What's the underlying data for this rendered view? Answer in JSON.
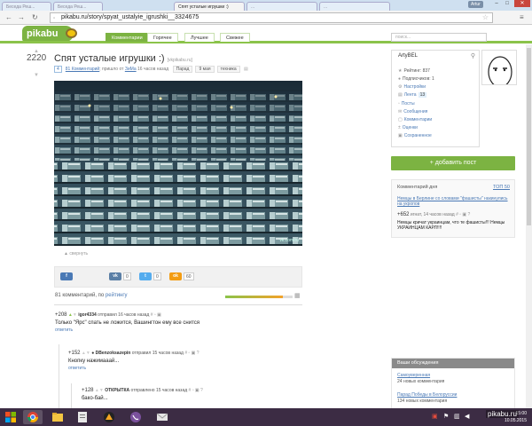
{
  "browser": {
    "tabs": [
      {
        "label": "Беседа Реш..."
      },
      {
        "label": "Беседа Реш..."
      },
      {
        "label": "Спят усталые игрушки :)"
      },
      {
        "label": "..."
      },
      {
        "label": "..."
      }
    ],
    "user": "Artur",
    "url": "pikabu.ru/story/spyat_ustalyie_igrushki__3324675"
  },
  "site": {
    "logo": "pikabu",
    "nav": [
      "Комментарии",
      "Горячее",
      "Лучшее",
      "Свежее"
    ],
    "search_placeholder": "поиск..."
  },
  "post": {
    "rating": "2220",
    "title": "Спят усталые игрушки :)",
    "source": "[vkpikabu.ru]",
    "badge": "4",
    "comments_link": "81 Комментарий",
    "posted_prefix": "; пришло от",
    "author": "ЗиМа",
    "time": "16 часов назад",
    "tags": [
      "Парад",
      "9 мая",
      "техника"
    ],
    "photo_watermark": "vk.com/ru"
  },
  "collapse_label": "свернуть",
  "share": {
    "counts": [
      "0",
      "0",
      "60"
    ]
  },
  "comments": {
    "count_text": "81 комментарий, по",
    "sort": "рейтингу",
    "progress": 0.85,
    "items": [
      {
        "score": "+208",
        "author": "igor4334",
        "time": "отправил 16 часов назад",
        "text": "Только \"Ярс\" спать не ложится, Вашингтон ему все снится",
        "reply": "ответить"
      },
      {
        "score": "+152",
        "author": "DBenzoksazepin",
        "time": "отправил 15 часов назад",
        "text": "Кнопку нажимааай...",
        "reply": "ответить"
      },
      {
        "score": "+128",
        "author": "ОТКРЫТКА",
        "time": "отправлено 15 часов назад",
        "text": "бако-бай...",
        "reply": ""
      }
    ]
  },
  "profile": {
    "name": "ArtyBEL",
    "rating": "Рейтинг: 837",
    "subscribers": "Подписчиков: 1",
    "settings": "Настройки",
    "feed": "Лента",
    "feed_count": "13",
    "posts": "Посты",
    "messages": "Сообщения",
    "comments": "Комментарии",
    "ratings": "Оценки",
    "saved": "Сохраненное"
  },
  "add_post": "+ добавить пост",
  "comment_of_day": {
    "header": "Комментарий дня",
    "top": "ТОП 50",
    "title": "Немцы в Берлине со словами \"фашисты\" накинулись на укропов",
    "score": "+652",
    "meta": "игнат, 14 часов назад",
    "text": "Немцы кричат украинцам, что те фашисты!!! Немцы УКРАИНЦАМ КАРЛ!!!!"
  },
  "discussions": {
    "header": "Ваши обсуждения",
    "items": [
      {
        "title": "Самоуверенная",
        "count": "24 новых комментария"
      },
      {
        "title": "Парад Победы в Белоруссии",
        "count": "134 новых комментария"
      }
    ]
  },
  "taskbar": {
    "time": "15:00",
    "date": "10.05.2015"
  },
  "watermark": "pikabu.ru",
  "colors": {
    "brand": "#7cb342",
    "link": "#4a79b5",
    "taskbar": "#3c2c44"
  }
}
